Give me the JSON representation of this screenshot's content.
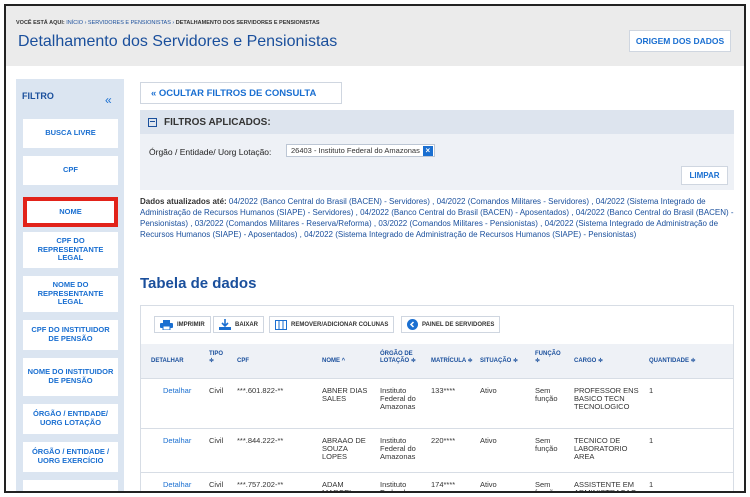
{
  "breadcrumb": {
    "prefix": "VOCÊ ESTÁ AQUI:",
    "path": "INÍCIO › SERVIDORES E PENSIONISTAS ›",
    "current": "DETALHAMENTO DOS SERVIDORES E PENSIONISTAS"
  },
  "page": {
    "title": "Detalhamento dos Servidores e Pensionistas",
    "origin_button": "ORIGEM DOS DADOS"
  },
  "sidebar": {
    "title": "FILTRO",
    "collapse_icon": "double-chevron-left-icon",
    "items": [
      {
        "label": "BUSCA LIVRE"
      },
      {
        "label": "CPF"
      },
      {
        "label": "NOME"
      },
      {
        "label": "CPF DO REPRESENTANTE LEGAL"
      },
      {
        "label": "NOME DO REPRESENTANTE LEGAL"
      },
      {
        "label": "CPF DO INSTITUIDOR DE PENSÃO"
      },
      {
        "label": "NOME DO INSTITUIDOR DE PENSÃO"
      },
      {
        "label": "ÓRGÃO / ENTIDADE/ UORG LOTAÇÃO"
      },
      {
        "label": "ÓRGÃO / ENTIDADE / UORG EXERCÍCIO"
      }
    ],
    "active_item": "NOME"
  },
  "filters": {
    "toggle_label": "« OCULTAR FILTROS DE CONSULTA",
    "applied_title": "FILTROS APLICADOS:",
    "label": "Órgão / Entidade/ Uorg Lotação:",
    "chip_value": "26403 - Instituto Federal do Amazonas",
    "clear_button": "LIMPAR"
  },
  "updated": {
    "label": "Dados atualizados até:",
    "text": "04/2022 (Banco Central do Brasil (BACEN) - Servidores) , 04/2022 (Comandos Militares - Servidores) , 04/2022 (Sistema Integrado de Administração de Recursos Humanos (SIAPE) - Servidores) , 04/2022 (Banco Central do Brasil (BACEN) - Aposentados) , 04/2022 (Banco Central do Brasil (BACEN) - Pensionistas) , 03/2022 (Comandos Militares - Reserva/Reforma) , 03/2022 (Comandos Militares - Pensionistas) , 04/2022 (Sistema Integrado de Administração de Recursos Humanos (SIAPE) - Aposentados) , 04/2022 (Sistema Integrado de Administração de Recursos Humanos (SIAPE) - Pensionistas)"
  },
  "table": {
    "title": "Tabela de dados",
    "toolbar": {
      "print": "IMPRIMIR",
      "download": "BAIXAR",
      "columns": "REMOVER/ADICIONAR COLUNAS",
      "panel": "PAINEL DE SERVIDORES"
    },
    "headers": {
      "detalhar": "DETALHAR",
      "tipo": "TIPO",
      "cpf": "CPF",
      "nome": "NOME ^",
      "orgao": "ÓRGÃO DE LOTAÇÃO ≑",
      "matricula": "MATRÍCULA ≑",
      "situacao": "SITUAÇÃO ≑",
      "funcao": "FUNÇÃO",
      "cargo": "CARGO ≑",
      "quantidade": "QUANTIDADE ≑",
      "sort_glyph": "≑"
    },
    "rows": [
      {
        "detalhar": "Detalhar",
        "tipo": "Civil",
        "cpf": "***.601.822-**",
        "nome": "ABNER DIAS SALES",
        "orgao": "Instituto Federal do Amazonas",
        "matricula": "133****",
        "situacao": "Ativo",
        "funcao": "Sem função",
        "cargo": "PROFESSOR ENS BASICO TECN TECNOLOGICO",
        "quantidade": "1"
      },
      {
        "detalhar": "Detalhar",
        "tipo": "Civil",
        "cpf": "***.844.222-**",
        "nome": "ABRAAO DE SOUZA LOPES",
        "orgao": "Instituto Federal do Amazonas",
        "matricula": "220****",
        "situacao": "Ativo",
        "funcao": "Sem função",
        "cargo": "TECNICO DE LABORATORIO AREA",
        "quantidade": "1"
      },
      {
        "detalhar": "Detalhar",
        "tipo": "Civil",
        "cpf": "***.757.202-**",
        "nome": "ADAM MARCEL",
        "orgao": "Instituto Federal",
        "matricula": "174****",
        "situacao": "Ativo",
        "funcao": "Sem função",
        "cargo": "ASSISTENTE EM ADMINISTRACAO",
        "quantidade": "1"
      }
    ]
  },
  "colors": {
    "brand_blue": "#1a4f9c",
    "link_blue": "#1a6fd1",
    "highlight_red": "#e2231a",
    "sidebar_bg": "#dbe5f1"
  }
}
